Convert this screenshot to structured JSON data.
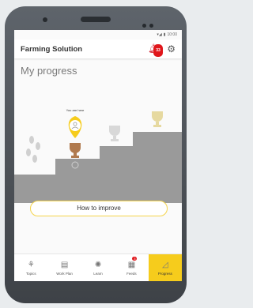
{
  "status_bar": {
    "time": "10:00"
  },
  "app_bar": {
    "title": "Farming Solution",
    "notification_count": "33"
  },
  "page": {
    "title": "My progress",
    "marker_label": "You are here"
  },
  "actions": {
    "improve_label": "How to improve"
  },
  "tabs": [
    {
      "label": "Topics",
      "icon": "plant-icon"
    },
    {
      "label": "Work Plan",
      "icon": "calendar-icon"
    },
    {
      "label": "Learn",
      "icon": "lightbulb-icon"
    },
    {
      "label": "Feeds",
      "icon": "feeds-icon",
      "badge": "3"
    },
    {
      "label": "Progress",
      "icon": "progress-icon",
      "active": true
    }
  ],
  "colors": {
    "accent": "#f6cc1c",
    "notification": "#e0161b",
    "steps": "#9a9a9a",
    "bronze": "#b07a4e",
    "silver": "#d8d8d8",
    "gold": "#e6d9a0"
  }
}
